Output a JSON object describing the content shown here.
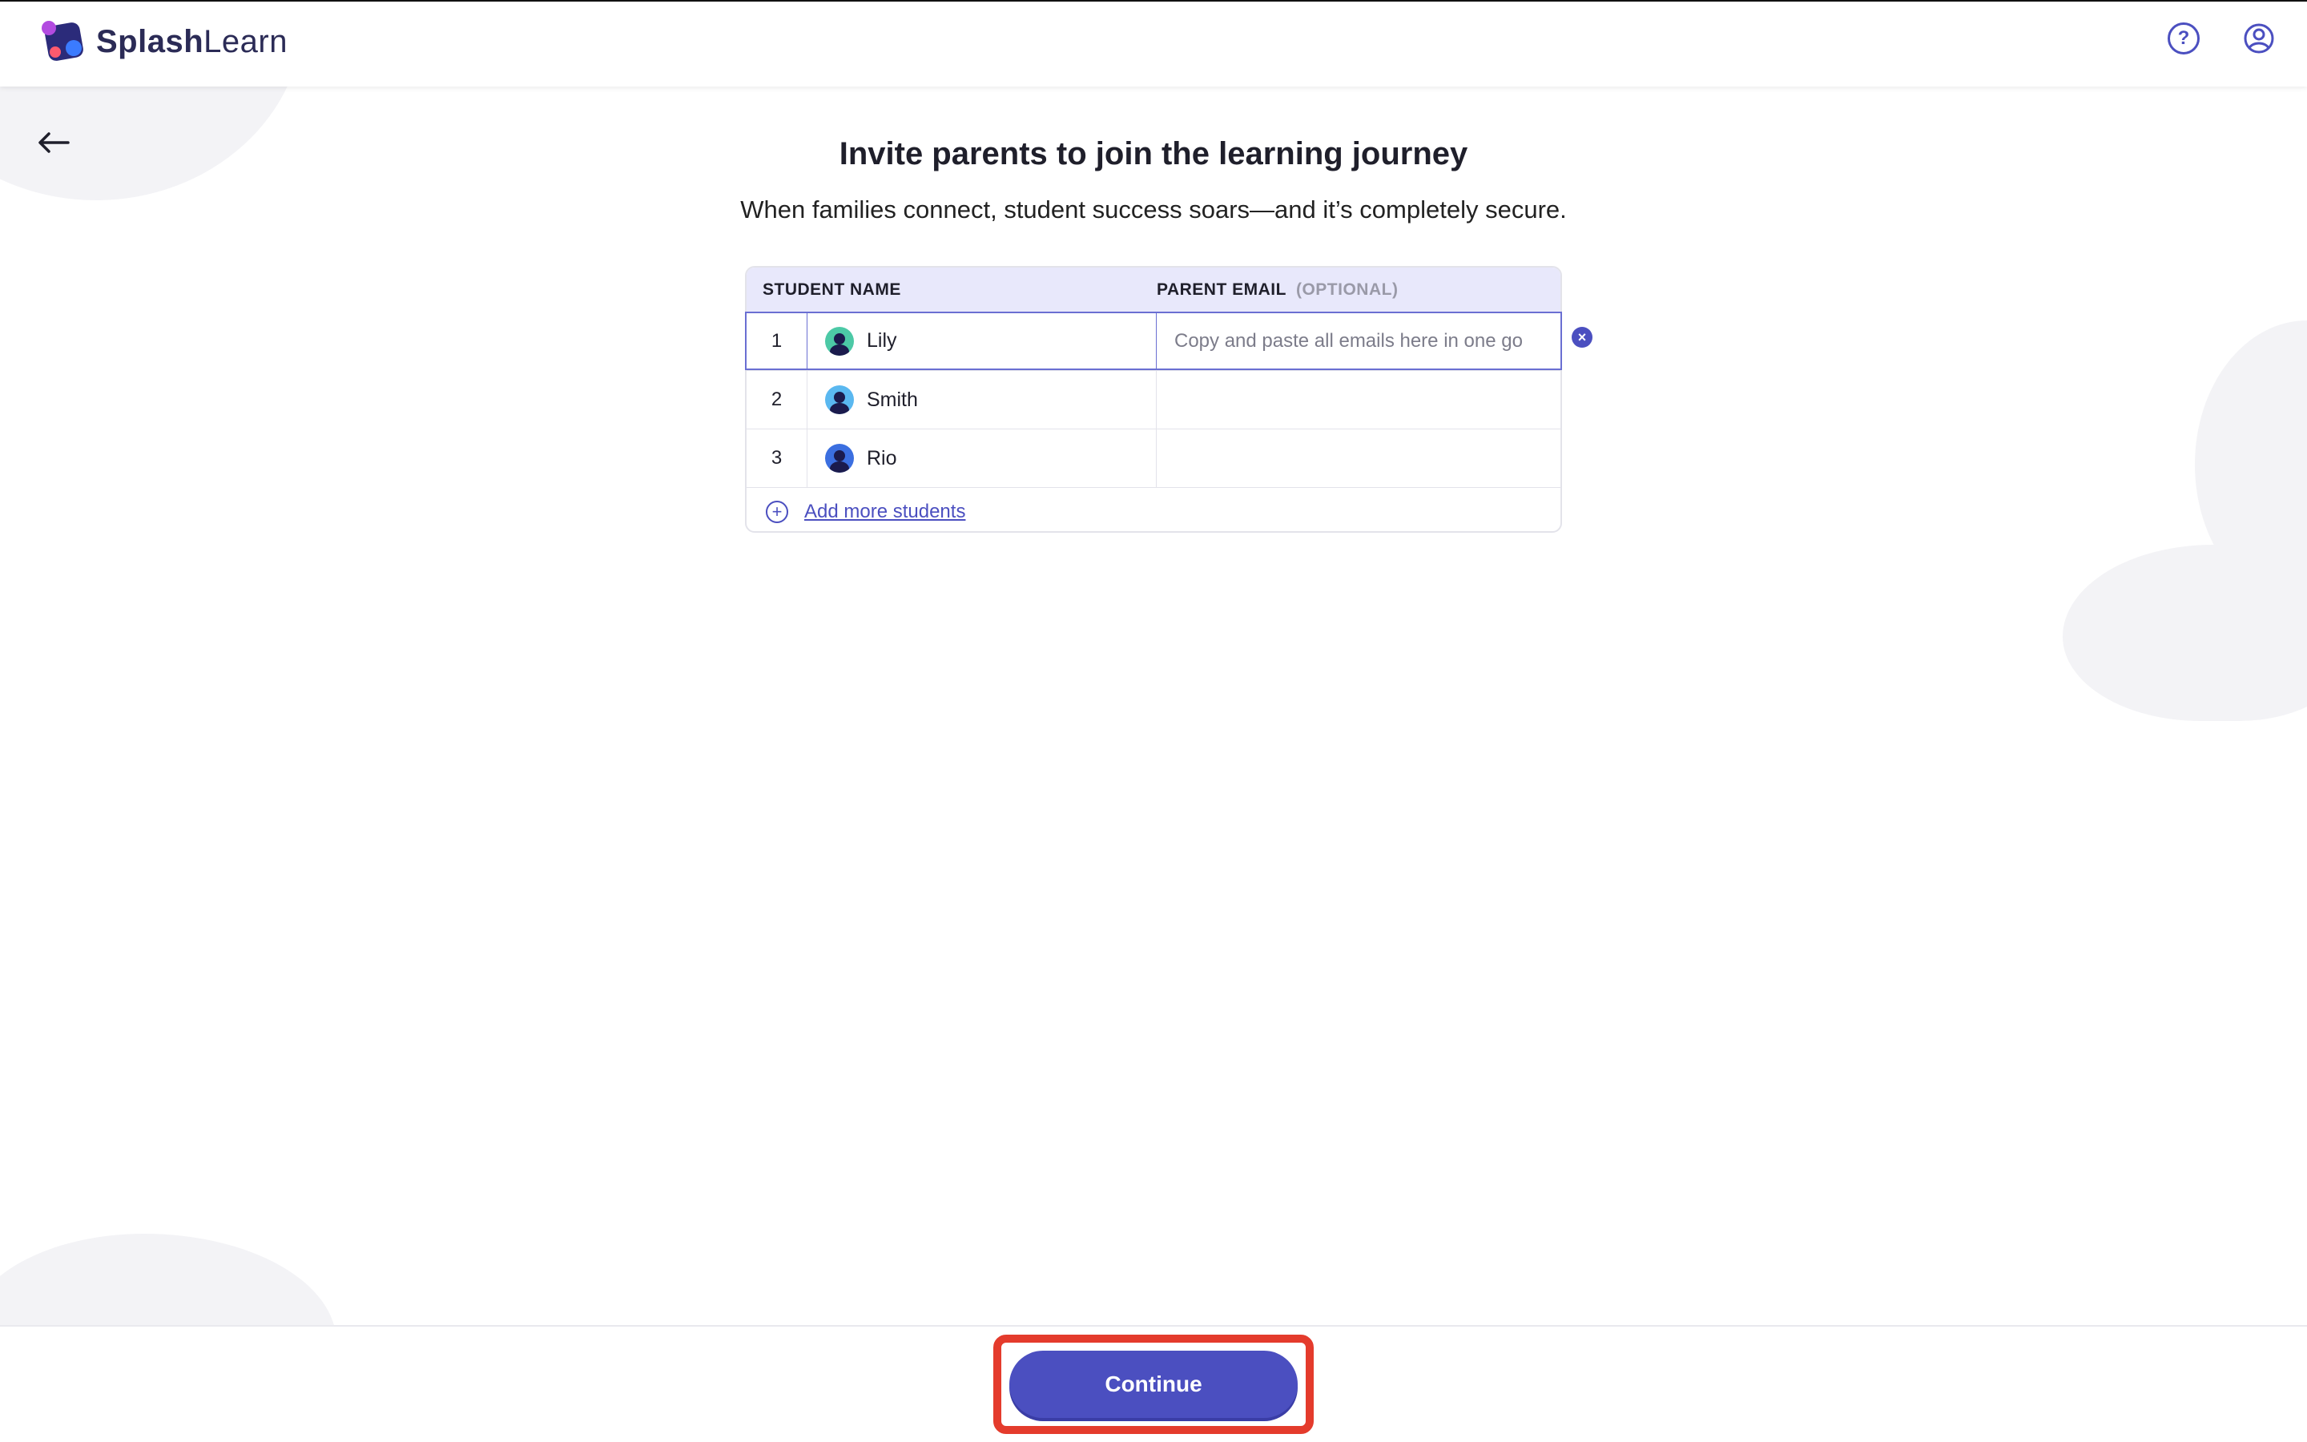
{
  "app": {
    "brand_part1": "Splash",
    "brand_part2": "Learn"
  },
  "header": {
    "help_icon": "help-icon",
    "account_icon": "user-account-icon"
  },
  "page": {
    "title": "Invite parents to join the learning journey",
    "subtitle": "When families connect, student success soars—and it’s completely secure."
  },
  "table": {
    "columns": {
      "student_name": "STUDENT NAME",
      "parent_email": "PARENT EMAIL",
      "optional": "(OPTIONAL)"
    },
    "rows": [
      {
        "index": "1",
        "name": "Lily",
        "email_placeholder": "Copy and paste all emails here in one go",
        "avatar_color": "#4cc9a6"
      },
      {
        "index": "2",
        "name": "Smith",
        "email_placeholder": "",
        "avatar_color": "#5ab8f0"
      },
      {
        "index": "3",
        "name": "Rio",
        "email_placeholder": "",
        "avatar_color": "#3b6fe0"
      }
    ],
    "add_more_label": "Add more students"
  },
  "footer": {
    "continue_label": "Continue"
  },
  "colors": {
    "brand": "#4b4fc0",
    "highlight": "#e43b2c"
  }
}
